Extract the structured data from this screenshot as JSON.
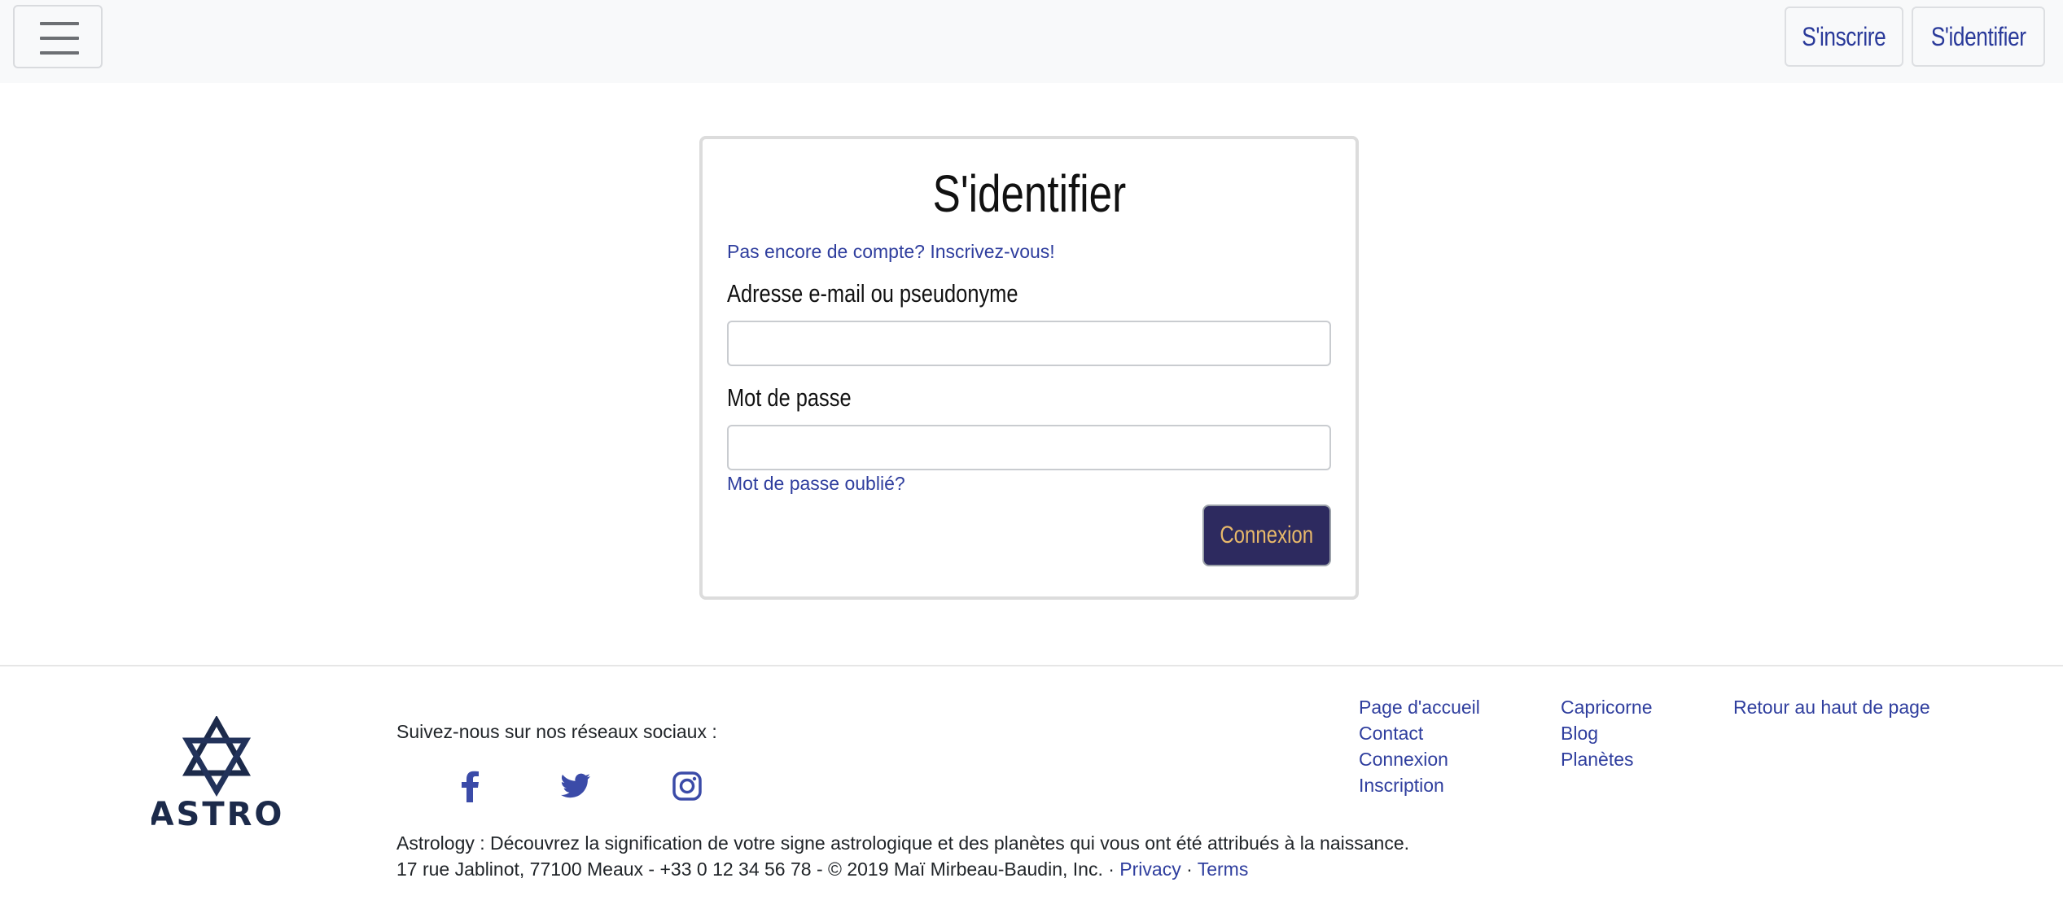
{
  "header": {
    "menu_toggle": "menu",
    "signup_label": "S'inscrire",
    "signin_label": "S'identifier"
  },
  "login": {
    "title": "S'identifier",
    "register_link": "Pas encore de compte? Inscrivez-vous!",
    "email_label": "Adresse e-mail ou pseudonyme",
    "email_value": "",
    "password_label": "Mot de passe",
    "password_value": "",
    "forgot_link": "Mot de passe oublié?",
    "submit_label": "Connexion"
  },
  "footer": {
    "logo_text": "ASTRO",
    "follow_text": "Suivez-nous sur nos réseaux sociaux :",
    "social": [
      "facebook-icon",
      "twitter-icon",
      "instagram-icon"
    ],
    "about_text": "Astrology : Découvrez la signification de votre signe astrologique et des planètes qui vous ont été attribués à la naissance.",
    "address_text": "17 rue Jablinot, 77100 Meaux - +33 0 12 34 56 78 - © 2019 Maï Mirbeau-Baudin, Inc. · ",
    "privacy_label": "Privacy",
    "separator": " · ",
    "terms_label": "Terms",
    "col1": [
      "Page d'accueil",
      "Contact",
      "Connexion",
      "Inscription"
    ],
    "col2": [
      "Capricorne",
      "Blog",
      "Planètes"
    ],
    "col3": [
      "Retour au haut de page"
    ]
  },
  "colors": {
    "link": "#2f3e9e",
    "button_bg": "#2d2a5f",
    "button_text": "#e8b96a",
    "logo": "#1c2a4a"
  }
}
